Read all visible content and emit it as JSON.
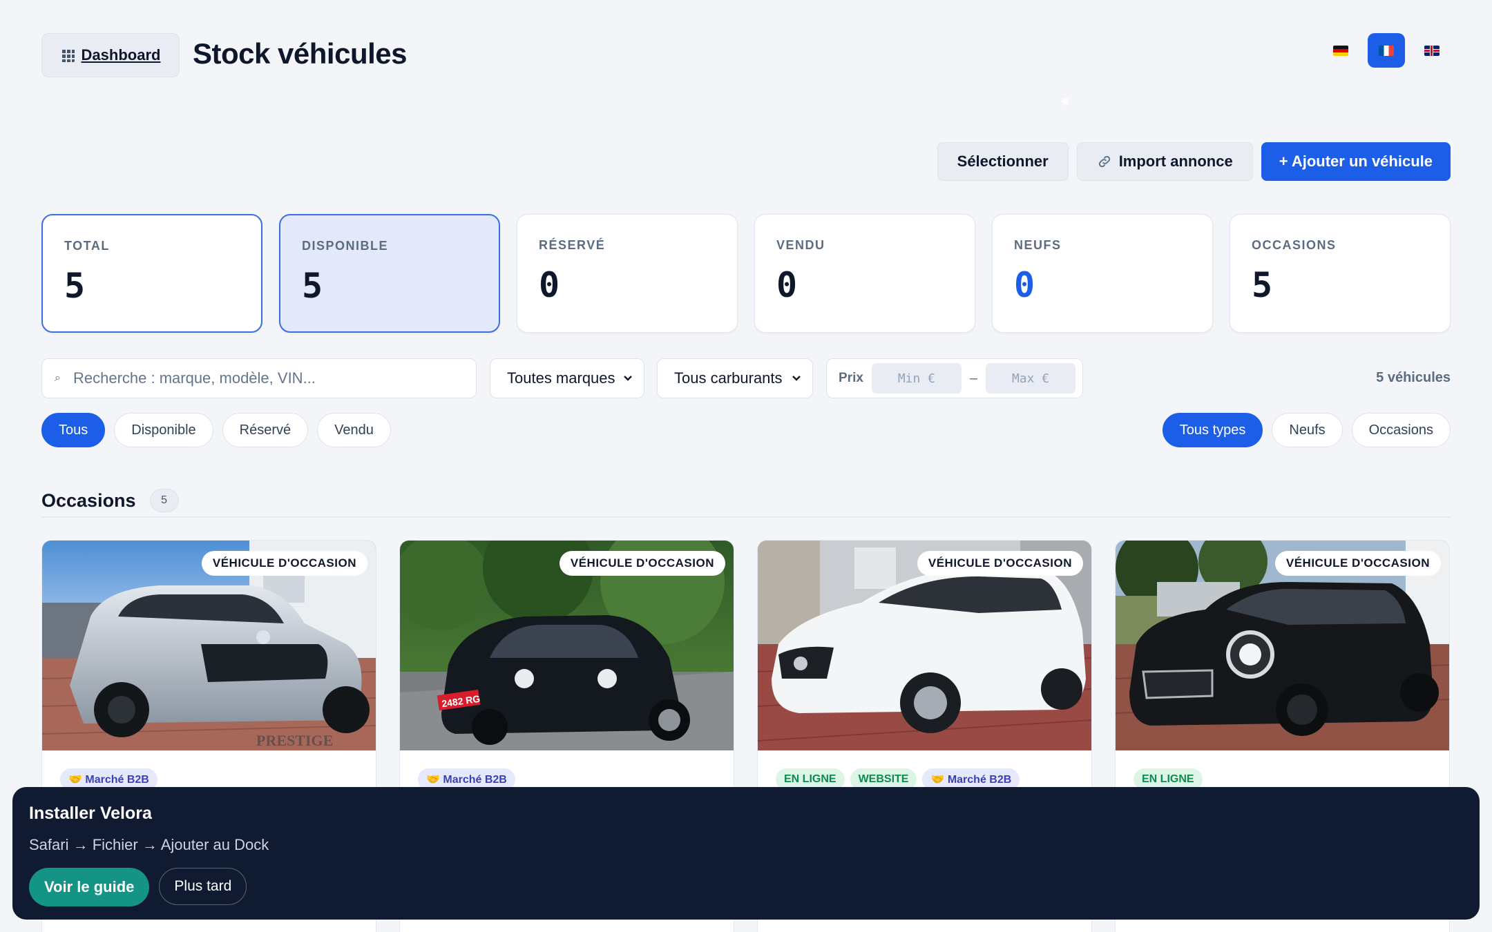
{
  "header": {
    "dashboard_label": "Dashboard",
    "title": "Stock véhicules",
    "languages": [
      {
        "code": "de",
        "icon": "german-flag-icon",
        "active": false
      },
      {
        "code": "fr",
        "icon": "french-flag-icon",
        "active": true
      },
      {
        "code": "en",
        "icon": "uk-flag-icon",
        "active": false
      }
    ]
  },
  "actions": {
    "select_label": "Sélectionner",
    "import_label": "Import annonce",
    "add_label": "+ Ajouter un véhicule"
  },
  "stats": [
    {
      "label": "TOTAL",
      "value": "5"
    },
    {
      "label": "DISPONIBLE",
      "value": "5"
    },
    {
      "label": "RÉSERVÉ",
      "value": "0"
    },
    {
      "label": "VENDU",
      "value": "0"
    },
    {
      "label": "NEUFS",
      "value": "0"
    },
    {
      "label": "OCCASIONS",
      "value": "5"
    }
  ],
  "filters": {
    "search_placeholder": "Recherche : marque, modèle, VIN...",
    "brand_select": "Toutes marques",
    "fuel_select": "Tous carburants",
    "price_label": "Prix",
    "price_min_placeholder": "Min €",
    "price_sep": "–",
    "price_max_placeholder": "Max €",
    "result_count": "5 véhicules",
    "status_chips": [
      "Tous",
      "Disponible",
      "Réservé",
      "Vendu"
    ],
    "type_chips": [
      "Tous types",
      "Neufs",
      "Occasions"
    ]
  },
  "section": {
    "title": "Occasions",
    "count": "5"
  },
  "cards": [
    {
      "badge": "VÉHICULE D'OCCASION",
      "tags": [
        "🤝 Marché B2B"
      ]
    },
    {
      "badge": "VÉHICULE D'OCCASION",
      "tags": [
        "🤝 Marché B2B"
      ]
    },
    {
      "badge": "VÉHICULE D'OCCASION",
      "tags": [
        "EN LIGNE",
        "WEBSITE",
        "🤝 Marché B2B"
      ]
    },
    {
      "badge": "VÉHICULE D'OCCASION",
      "tags": [
        "EN LIGNE"
      ]
    }
  ],
  "photo_text": {
    "plate": "2482 RG",
    "watermark": "PRESTIGE"
  },
  "banner": {
    "title": "Installer Velora",
    "subtitle": "Safari → Fichier → Ajouter au Dock",
    "guide_label": "Voir le guide",
    "later_label": "Plus tard"
  },
  "colors": {
    "accent": "#1d5ee8",
    "banner_bg": "#101a30",
    "guide_button": "#149484"
  }
}
